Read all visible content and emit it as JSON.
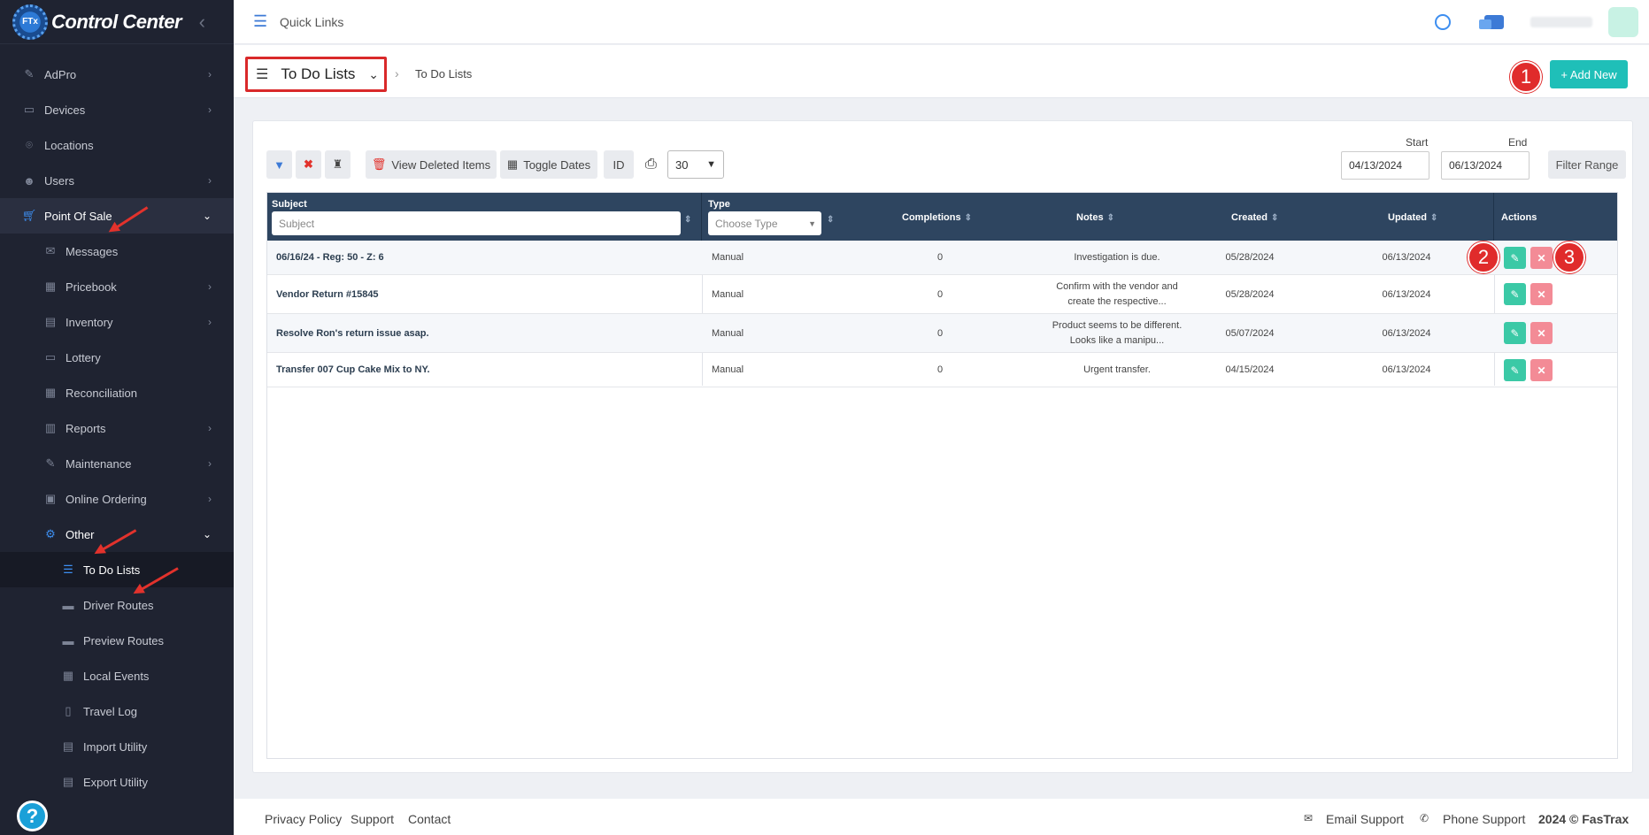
{
  "app": {
    "brand": "Control Center",
    "logo_text": "FTx"
  },
  "topbar": {
    "quick_links": "Quick Links"
  },
  "sidebar": {
    "items": [
      {
        "label": "AdPro",
        "icon": "rocket-icon"
      },
      {
        "label": "Devices",
        "icon": "devices-icon"
      },
      {
        "label": "Locations",
        "icon": "map-pin-icon"
      },
      {
        "label": "Users",
        "icon": "users-icon"
      },
      {
        "label": "Point Of Sale",
        "icon": "cart-icon"
      },
      {
        "label": "Messages",
        "icon": "envelope-icon"
      },
      {
        "label": "Pricebook",
        "icon": "calculator-icon"
      },
      {
        "label": "Inventory",
        "icon": "inventory-icon"
      },
      {
        "label": "Lottery",
        "icon": "ticket-icon"
      },
      {
        "label": "Reconciliation",
        "icon": "grid-icon"
      },
      {
        "label": "Reports",
        "icon": "chart-icon"
      },
      {
        "label": "Maintenance",
        "icon": "wrench-icon"
      },
      {
        "label": "Online Ordering",
        "icon": "shopping-bag-icon"
      },
      {
        "label": "Other",
        "icon": "cogs-icon"
      },
      {
        "label": "To Do Lists",
        "icon": "list-icon"
      },
      {
        "label": "Driver Routes",
        "icon": "bus-icon"
      },
      {
        "label": "Preview Routes",
        "icon": "bus-icon"
      },
      {
        "label": "Local Events",
        "icon": "calendar-icon"
      },
      {
        "label": "Travel Log",
        "icon": "book-icon"
      },
      {
        "label": "Import Utility",
        "icon": "import-icon"
      },
      {
        "label": "Export Utility",
        "icon": "export-icon"
      }
    ],
    "help": "?"
  },
  "subbar": {
    "page_select": "To Do Lists",
    "breadcrumb": "To Do Lists",
    "add_new": "+ Add New"
  },
  "badges": [
    "1",
    "2",
    "3"
  ],
  "toolbar": {
    "view_deleted": "View Deleted Items",
    "toggle_dates": "Toggle Dates",
    "id": "ID",
    "page_size": "30",
    "start_label": "Start",
    "end_label": "End",
    "start_date": "04/13/2024",
    "end_date": "06/13/2024",
    "filter_range": "Filter Range"
  },
  "table": {
    "headers": {
      "subject": "Subject",
      "subject_placeholder": "Subject",
      "type": "Type",
      "type_placeholder": "Choose Type",
      "completions": "Completions",
      "notes": "Notes",
      "created": "Created",
      "updated": "Updated",
      "actions": "Actions"
    },
    "rows": [
      {
        "subject": "06/16/24 - Reg: 50 - Z: 6",
        "type": "Manual",
        "completions": "0",
        "notes": "Investigation is due.",
        "notes2": "",
        "created": "05/28/2024",
        "updated": "06/13/2024"
      },
      {
        "subject": "Vendor Return #15845",
        "type": "Manual",
        "completions": "0",
        "notes": "Confirm with the vendor and",
        "notes2": "create the respective...",
        "created": "05/28/2024",
        "updated": "06/13/2024"
      },
      {
        "subject": "Resolve Ron's return issue asap.",
        "type": "Manual",
        "completions": "0",
        "notes": "Product seems to be different.",
        "notes2": "Looks like a manipu...",
        "created": "05/07/2024",
        "updated": "06/13/2024"
      },
      {
        "subject": "Transfer 007 Cup Cake Mix to NY.",
        "type": "Manual",
        "completions": "0",
        "notes": "Urgent transfer.",
        "notes2": "",
        "created": "04/15/2024",
        "updated": "06/13/2024"
      }
    ]
  },
  "footer": {
    "privacy": "Privacy Policy",
    "support": "Support",
    "contact": "Contact",
    "email_support": "Email Support",
    "phone_support": "Phone Support",
    "copyright": "2024 © FasTrax"
  },
  "colors": {
    "accent": "#1fbfb8",
    "sidebar_bg": "#1f2331",
    "table_header": "#2e4560",
    "annotation_red": "#e02b2b"
  }
}
